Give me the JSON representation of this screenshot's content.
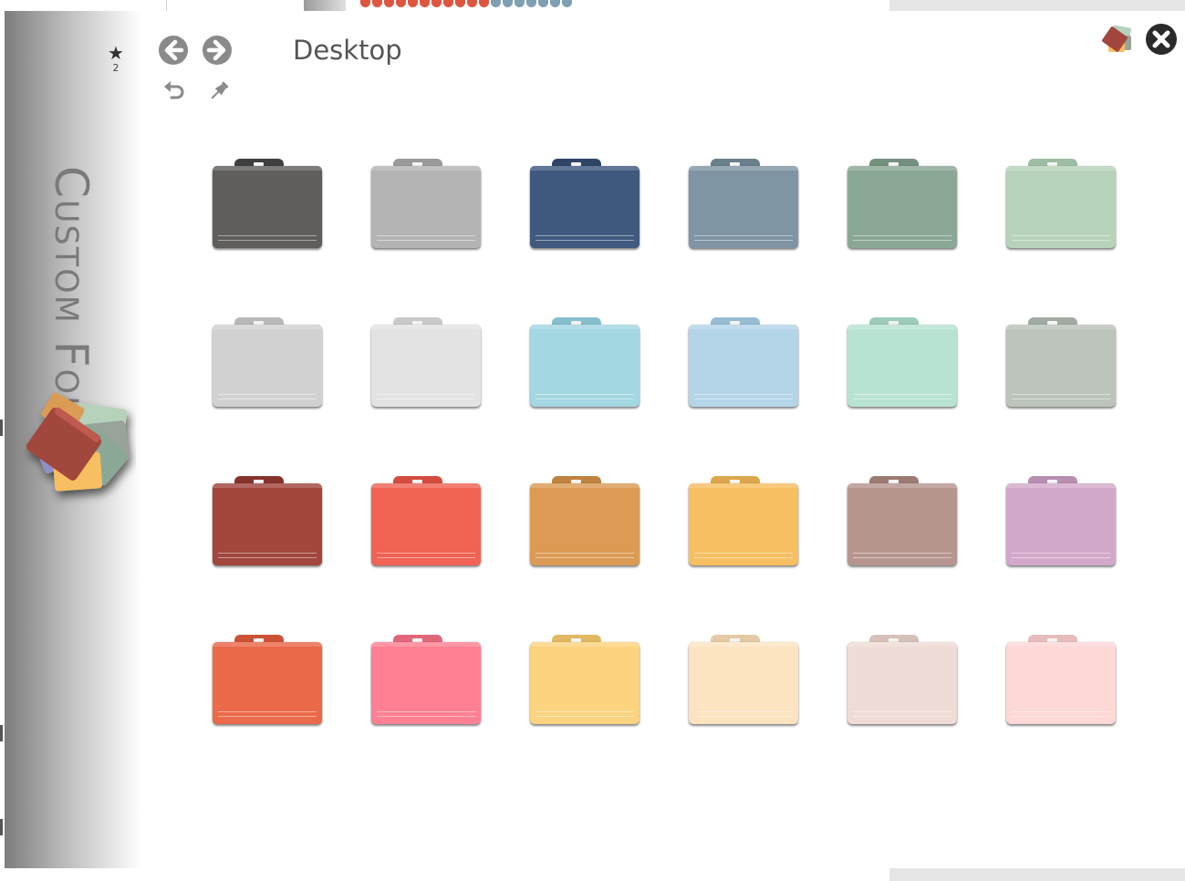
{
  "window": {
    "title": "Desktop",
    "brand": "Custom Folder",
    "star_count": "2"
  },
  "icons": {
    "star": "star-icon",
    "back": "arrow-left-circle-icon",
    "forward": "arrow-right-circle-icon",
    "undo": "undo-icon",
    "pin": "pin-icon",
    "app": "custom-folder-logo-icon",
    "close": "close-circle-icon"
  },
  "colors": {
    "sidebar_dark": "#7d7d7d",
    "title_text": "#555555",
    "nav_icon": "#8a8a8a",
    "close_icon": "#2a2a2a"
  },
  "folders": [
    {
      "color": "#5f5e5c",
      "tab": "#3f3f3f"
    },
    {
      "color": "#b4b4b4",
      "tab": "#9a9a9a"
    },
    {
      "color": "#40597f",
      "tab": "#304466"
    },
    {
      "color": "#7f95a3",
      "tab": "#6a7f8c"
    },
    {
      "color": "#8ba896",
      "tab": "#76907f"
    },
    {
      "color": "#b6d2bb",
      "tab": "#9fbca4"
    },
    {
      "color": "#d1d1d1",
      "tab": "#b8b8b8"
    },
    {
      "color": "#e3e3e3",
      "tab": "#c9c9c9"
    },
    {
      "color": "#a3d7e2",
      "tab": "#86bfcb"
    },
    {
      "color": "#b4d5e8",
      "tab": "#98bcd1"
    },
    {
      "color": "#b8e3d1",
      "tab": "#9dcbb8"
    },
    {
      "color": "#bcc4bb",
      "tab": "#a2ab a1"
    },
    {
      "color": "#a2463e",
      "tab": "#86332d"
    },
    {
      "color": "#f06355",
      "tab": "#d44c40"
    },
    {
      "color": "#db9b54",
      "tab": "#bf8240"
    },
    {
      "color": "#f8bf62",
      "tab": "#dca74c"
    },
    {
      "color": "#b7958f",
      "tab": "#9d7b75"
    },
    {
      "color": "#d3a9cb",
      "tab": "#b78fb0"
    },
    {
      "color": "#ea6a4a",
      "tab": "#cc5236"
    },
    {
      "color": "#fe8092",
      "tab": "#e2677a"
    },
    {
      "color": "#fcd37f",
      "tab": "#e2b963"
    },
    {
      "color": "#fde4c1",
      "tab": "#e4cba6"
    },
    {
      "color": "#f0dcd6",
      "tab": "#d6c1bb"
    },
    {
      "color": "#fed7d7",
      "tab": "#e6bcbc"
    }
  ]
}
